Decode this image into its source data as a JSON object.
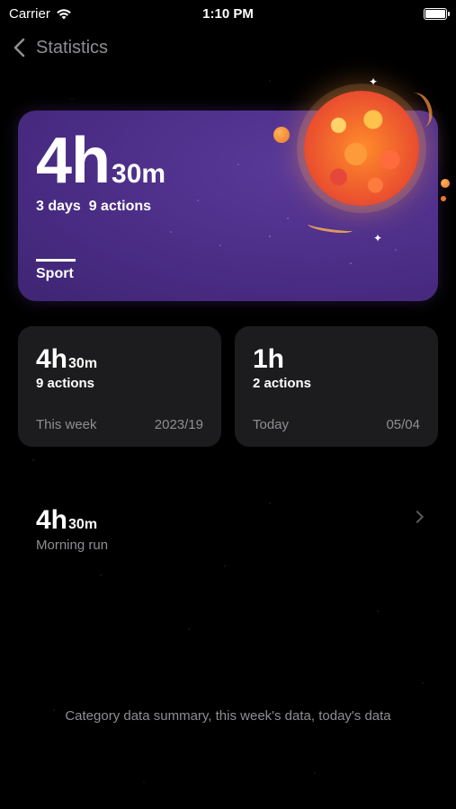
{
  "status_bar": {
    "carrier": "Carrier",
    "time": "1:10 PM",
    "wifi_icon": "wifi-icon",
    "battery_icon": "battery-icon"
  },
  "nav": {
    "back_icon": "chevron-left-icon",
    "title": "Statistics"
  },
  "hero": {
    "hours": "4h",
    "minutes": "30m",
    "summary": "3 days  9 actions",
    "category": "Sport",
    "card_color": "#4b2d86"
  },
  "cards": [
    {
      "hours": "4h",
      "minutes": "30m",
      "actions": "9 actions",
      "label": "This week",
      "value": "2023/19"
    },
    {
      "hours": "1h",
      "minutes": "",
      "actions": "2 actions",
      "label": "Today",
      "value": "05/04"
    }
  ],
  "activity": {
    "hours": "4h",
    "minutes": "30m",
    "name": "Morning run",
    "chevron_icon": "chevron-right-icon"
  },
  "footer_note": "Category data summary, this week's data, today's data"
}
